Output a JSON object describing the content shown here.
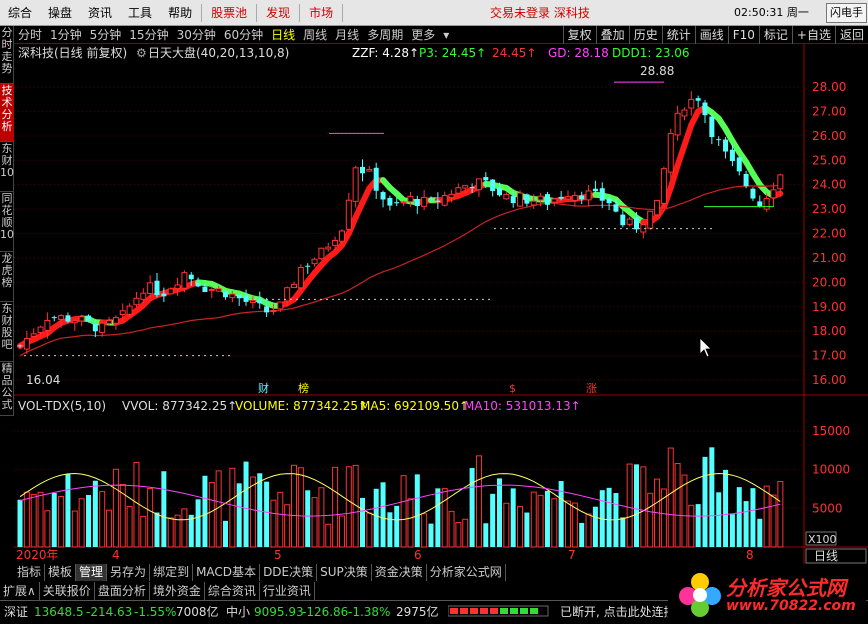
{
  "menu": {
    "items": [
      "综合",
      "操盘",
      "资讯",
      "工具",
      "帮助"
    ],
    "red_items": [
      "股票池",
      "发现",
      "市场"
    ],
    "status": "交易未登录  深科技",
    "time": "02:50:31 周一",
    "flash": "闪电手"
  },
  "side_tabs": [
    "分时走势",
    "技术分析",
    "东财10",
    "同花顺10",
    "龙虎榜",
    "东财股吧",
    "精品公式"
  ],
  "period": {
    "items": [
      "分时",
      "1分钟",
      "5分钟",
      "15分钟",
      "30分钟",
      "60分钟",
      "日线",
      "周线",
      "月线",
      "多周期",
      "更多"
    ],
    "active": "日线",
    "right_buttons": [
      "复权",
      "叠加",
      "历史",
      "统计",
      "画线",
      "F10",
      "标记",
      "+自选",
      "返回"
    ]
  },
  "header": {
    "title": "深科技(日线 前复权)",
    "indicator": "日天大盘(40,20,13,10,8)",
    "zzf": "ZZF: 4.28↑",
    "p3": "P3: 24.45↑",
    "p3b": "24.45↑",
    "gd": "GD: 28.18",
    "ddd1": "DDD1: 23.06"
  },
  "price_axis": {
    "ticks": [
      "28.00",
      "27.00",
      "26.00",
      "25.00",
      "24.00",
      "23.00",
      "22.00",
      "21.00",
      "20.00",
      "19.00",
      "18.00",
      "17.00",
      "16.00"
    ],
    "high_label": "28.88",
    "low_label": "16.04"
  },
  "event_marks": [
    "财",
    "榜",
    "$",
    "涨"
  ],
  "volume": {
    "title": "VOL-TDX(5,10)",
    "vvol": "VVOL: 877342.25↑",
    "volume": "VOLUME: 877342.25↑",
    "ma5": "MA5: 692109.50↑",
    "ma10": "MA10: 531013.13↑",
    "ticks": [
      "15000",
      "10000",
      "5000"
    ],
    "unit": "X100"
  },
  "date_axis": {
    "labels": [
      "2020年",
      "4",
      "5",
      "6",
      "7",
      "8"
    ],
    "cycle": "日线"
  },
  "bottom_tabs": [
    "指标",
    "模板",
    "管理",
    "另存为",
    "绑定到",
    "MACD基本",
    "DDE决策",
    "SUP决策",
    "资金决策",
    "分析家公式网"
  ],
  "bottom_tabs_active": "管理",
  "bottom_tabs2": [
    "扩展∧",
    "关联报价",
    "盘面分析",
    "境外资金",
    "综合资讯",
    "行业资讯"
  ],
  "status": {
    "sh_label": "深证",
    "sh_value": "13648.5",
    "sh_change": "-214.63",
    "sh_pct": "-1.55%",
    "sh_amount": "7008亿",
    "zx_label": "中小",
    "zx_value": "9095.93",
    "zx_change": "-126.86",
    "zx_pct": "-1.38%",
    "zx_amount": "2975亿",
    "message": "已断开, 点击此处连接"
  },
  "logo": {
    "name": "分析家公式网",
    "url": "www.70822.com"
  },
  "colors": {
    "up": "#ff3232",
    "down": "#54ffff",
    "ribbon_up": "#ff1a1a",
    "ribbon_down": "#55ff55",
    "ma_red": "#cc2222"
  }
}
